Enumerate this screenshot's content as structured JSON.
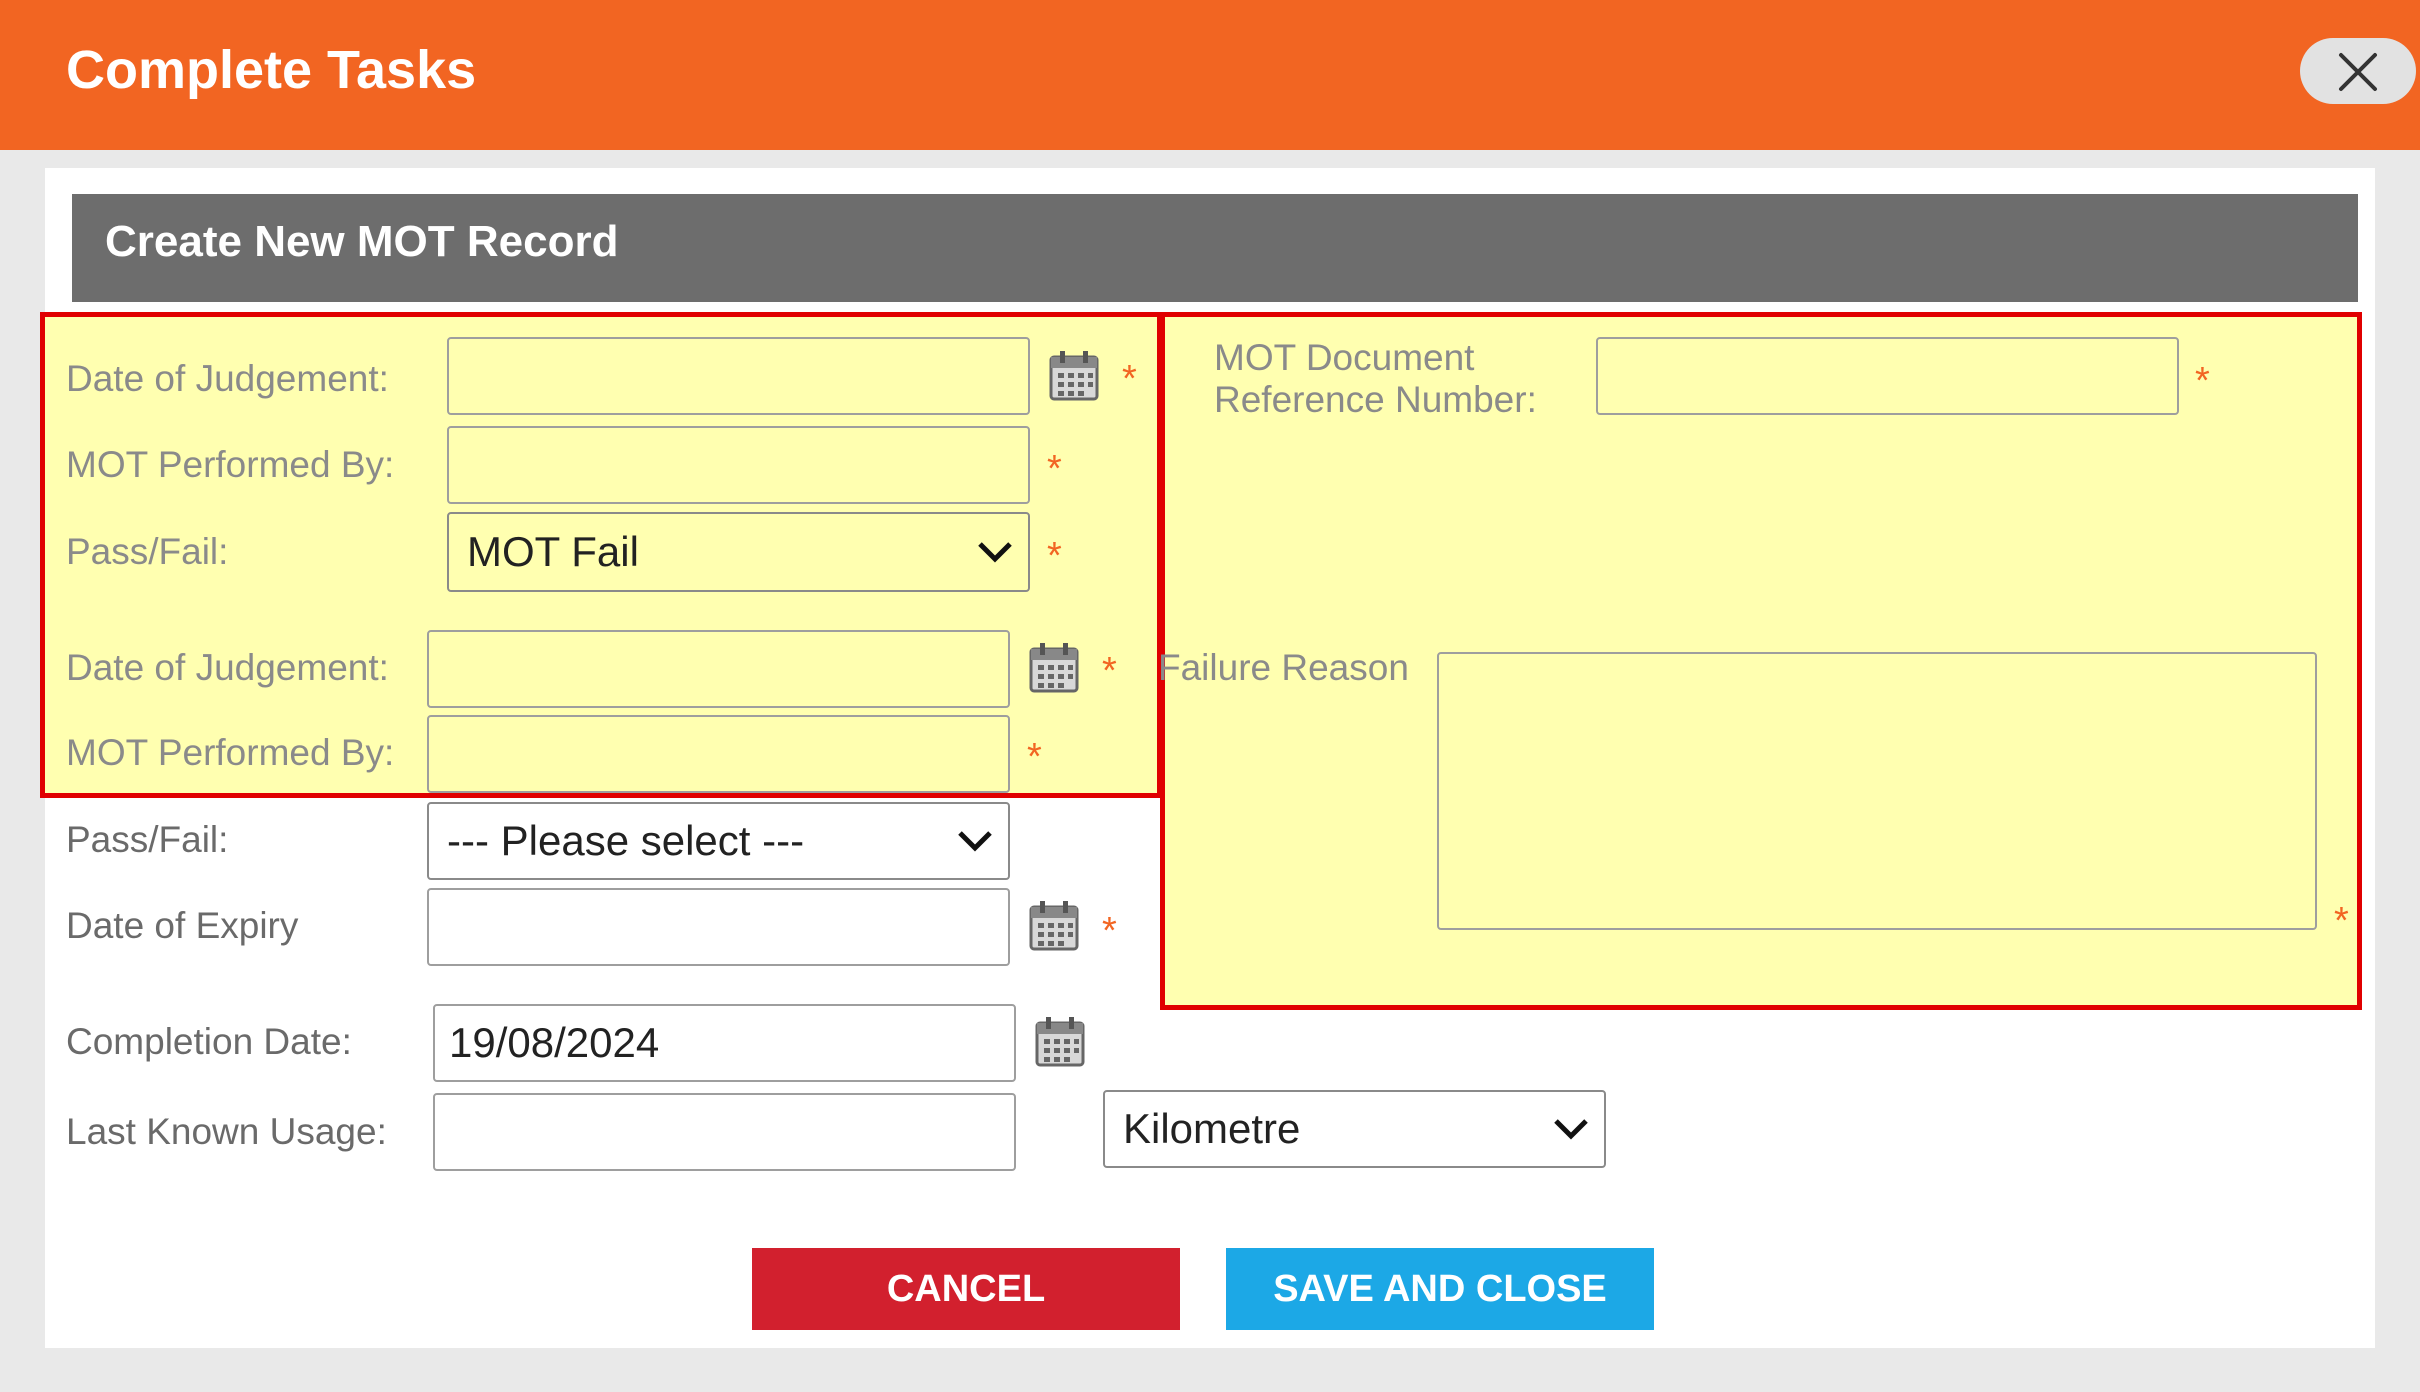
{
  "dialog": {
    "title": "Complete Tasks"
  },
  "section": {
    "title": "Create New MOT Record"
  },
  "required_marker": "*",
  "form": {
    "date_of_judgement_1": {
      "label": "Date of Judgement:",
      "value": ""
    },
    "mot_performed_by_1": {
      "label": "MOT Performed By:",
      "value": ""
    },
    "pass_fail_1": {
      "label": "Pass/Fail:",
      "selected": "MOT Fail"
    },
    "date_of_judgement_2": {
      "label": "Date of Judgement:",
      "value": ""
    },
    "mot_performed_by_2": {
      "label": "MOT Performed By:",
      "value": ""
    },
    "pass_fail_2": {
      "label": "Pass/Fail:",
      "selected": "--- Please select ---"
    },
    "date_of_expiry": {
      "label": "Date of Expiry",
      "value": ""
    },
    "mot_doc_ref": {
      "label_line1": "MOT Document",
      "label_line2": "Reference Number:",
      "value": ""
    },
    "failure_reason": {
      "label": "Failure Reason",
      "value": ""
    },
    "completion_date": {
      "label": "Completion Date:",
      "value": "19/08/2024"
    },
    "last_known_usage": {
      "label": "Last Known Usage:",
      "value": "",
      "unit_selected": "Kilometre"
    }
  },
  "buttons": {
    "cancel": "CANCEL",
    "save_close": "SAVE AND CLOSE"
  },
  "colors": {
    "header": "#f26522",
    "section_bar": "#6d6d6d",
    "highlight_fill": "#ffffb0",
    "highlight_border": "#e00000",
    "cancel": "#d2202e",
    "save": "#1ca8e6"
  },
  "icons": [
    "close-icon",
    "calendar-icon",
    "chevron-down-icon"
  ]
}
